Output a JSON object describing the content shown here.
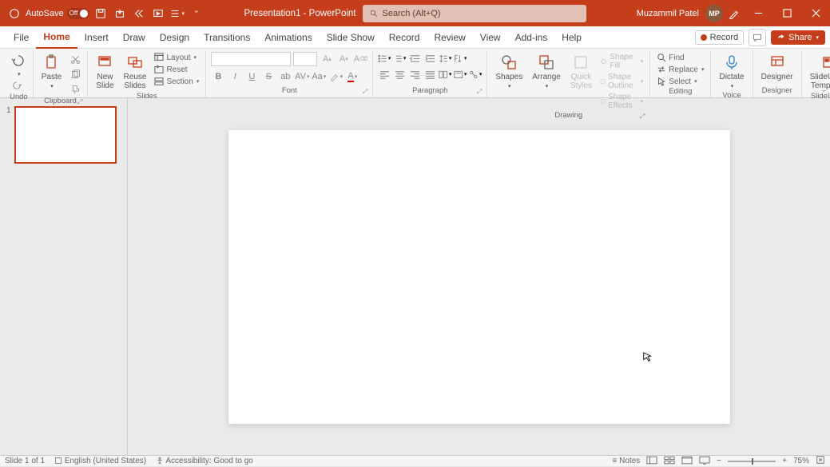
{
  "titlebar": {
    "autosave_label": "AutoSave",
    "autosave_state": "Off",
    "doc_title": "Presentation1 - PowerPoint",
    "search_placeholder": "Search (Alt+Q)",
    "user_name": "Muzammil Patel",
    "user_initials": "MP"
  },
  "tabs": {
    "items": [
      "File",
      "Home",
      "Insert",
      "Draw",
      "Design",
      "Transitions",
      "Animations",
      "Slide Show",
      "Record",
      "Review",
      "View",
      "Add-ins",
      "Help"
    ],
    "active": "Home",
    "record_label": "Record",
    "share_label": "Share"
  },
  "ribbon": {
    "undo": {
      "group_label": "Undo"
    },
    "clipboard": {
      "paste": "Paste",
      "group_label": "Clipboard"
    },
    "slides": {
      "new_slide": "New\nSlide",
      "reuse_slides": "Reuse\nSlides",
      "layout": "Layout",
      "reset": "Reset",
      "section": "Section",
      "group_label": "Slides"
    },
    "font": {
      "font_name": "",
      "font_size": "",
      "group_label": "Font"
    },
    "paragraph": {
      "group_label": "Paragraph"
    },
    "drawing": {
      "shapes": "Shapes",
      "arrange": "Arrange",
      "quick": "Quick\nStyles",
      "shape_fill": "Shape Fill",
      "shape_outline": "Shape Outline",
      "shape_effects": "Shape Effects",
      "group_label": "Drawing"
    },
    "editing": {
      "find": "Find",
      "replace": "Replace",
      "select": "Select",
      "group_label": "Editing"
    },
    "voice": {
      "dictate": "Dictate",
      "group_label": "Voice"
    },
    "designer": {
      "designer": "Designer",
      "group_label": "Designer"
    },
    "slideuplift": {
      "templates": "SlideUpLift\nTemplates",
      "group_label": "SlideUpLift"
    }
  },
  "thumbnails": {
    "num": "1"
  },
  "status": {
    "slide": "Slide 1 of 1",
    "lang": "English (United States)",
    "access": "Accessibility: Good to go",
    "notes": "Notes",
    "zoom": "75%"
  }
}
